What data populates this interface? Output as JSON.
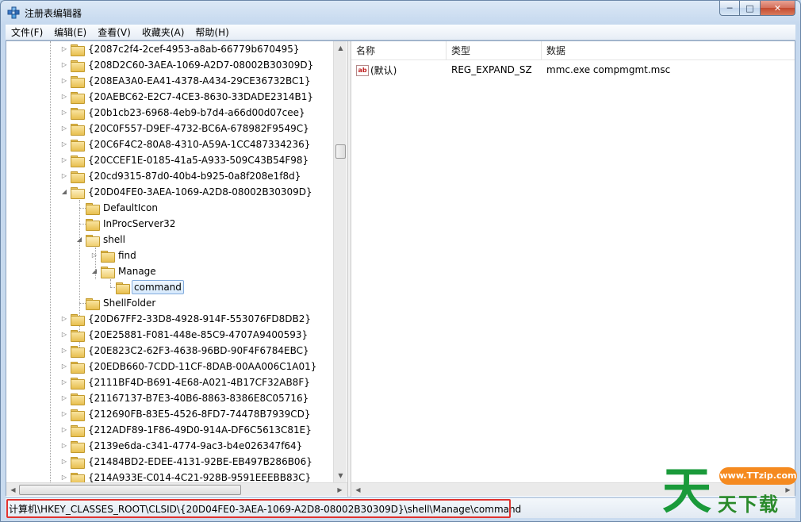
{
  "window": {
    "title": "注册表编辑器",
    "minimize_label": "─",
    "maximize_label": "□",
    "close_label": "✕"
  },
  "menu": [
    "文件(F)",
    "编辑(E)",
    "查看(V)",
    "收藏夹(A)",
    "帮助(H)"
  ],
  "tree": {
    "rows": [
      {
        "label": "{2087c2f4-2cef-4953-a8ab-66779b670495}",
        "expander": "▷"
      },
      {
        "label": "{208D2C60-3AEA-1069-A2D7-08002B30309D}",
        "expander": "▷"
      },
      {
        "label": "{208EA3A0-EA41-4378-A434-29CE36732BC1}",
        "expander": "▷"
      },
      {
        "label": "{20AEBC62-E2C7-4CE3-8630-33DADE2314B1}",
        "expander": "▷"
      },
      {
        "label": "{20b1cb23-6968-4eb9-b7d4-a66d00d07cee}",
        "expander": "▷"
      },
      {
        "label": "{20C0F557-D9EF-4732-BC6A-678982F9549C}",
        "expander": "▷"
      },
      {
        "label": "{20C6F4C2-80A8-4310-A59A-1CC487334236}",
        "expander": "▷"
      },
      {
        "label": "{20CCEF1E-0185-41a5-A933-509C43B54F98}",
        "expander": "▷"
      },
      {
        "label": "{20cd9315-87d0-40b4-b925-0a8f208e1f8d}",
        "expander": "▷"
      },
      {
        "label": "{20D04FE0-3AEA-1069-A2D8-08002B30309D}",
        "expander": "◢"
      },
      {
        "label": "DefaultIcon",
        "expander": ""
      },
      {
        "label": "InProcServer32",
        "expander": ""
      },
      {
        "label": "shell",
        "expander": "◢"
      },
      {
        "label": "find",
        "expander": "▷"
      },
      {
        "label": "Manage",
        "expander": "◢"
      },
      {
        "label": "command",
        "expander": ""
      },
      {
        "label": "ShellFolder",
        "expander": ""
      },
      {
        "label": "{20D67FF2-33D8-4928-914F-553076FD8DB2}",
        "expander": "▷"
      },
      {
        "label": "{20E25881-F081-448e-85C9-4707A9400593}",
        "expander": "▷"
      },
      {
        "label": "{20E823C2-62F3-4638-96BD-90F4F6784EBC}",
        "expander": "▷"
      },
      {
        "label": "{20EDB660-7CDD-11CF-8DAB-00AA006C1A01}",
        "expander": "▷"
      },
      {
        "label": "{2111BF4D-B691-4E68-A021-4B17CF32AB8F}",
        "expander": "▷"
      },
      {
        "label": "{21167137-B7E3-40B6-8863-8386E8C05716}",
        "expander": "▷"
      },
      {
        "label": "{212690FB-83E5-4526-8FD7-74478B7939CD}",
        "expander": "▷"
      },
      {
        "label": "{212ADF89-1F86-49D0-914A-DF6C5613C81E}",
        "expander": "▷"
      },
      {
        "label": "{2139e6da-c341-4774-9ac3-b4e026347f64}",
        "expander": "▷"
      },
      {
        "label": "{21484BD2-EDEE-4131-92BE-EB497B286B06}",
        "expander": "▷"
      },
      {
        "label": "{214A933E-C014-4C21-928B-9591EEEBB83C}",
        "expander": "▷"
      }
    ],
    "selected": "command"
  },
  "list": {
    "columns": [
      "名称",
      "类型",
      "数据"
    ],
    "rows": [
      {
        "icon": "ab",
        "name": "(默认)",
        "type": "REG_EXPAND_SZ",
        "data": "mmc.exe compmgmt.msc"
      }
    ]
  },
  "statusbar": {
    "path": "计算机\\HKEY_CLASSES_ROOT\\CLSID\\{20D04FE0-3AEA-1069-A2D8-08002B30309D}\\shell\\Manage\\command"
  },
  "watermark": {
    "char": "天",
    "url": "www.TTzip.com",
    "sub": "天下载"
  },
  "colors": {
    "highlight_box": "#e0332f",
    "watermark_green": "#1a9a3a",
    "watermark_orange": "#f58a1f"
  }
}
